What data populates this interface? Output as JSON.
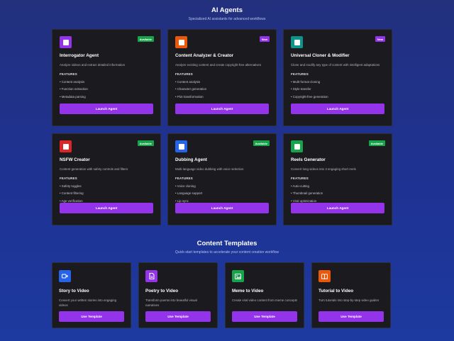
{
  "agents_section": {
    "title": "AI Agents",
    "subtitle": "Specialized AI assistants for advanced workflows",
    "features_heading": "FEATURES",
    "cards": [
      {
        "title": "Interrogator Agent",
        "badge": "Available",
        "badge_color": "#16a34a",
        "icon_color": "#9333ea",
        "icon_name": "agent-icon",
        "description": "Analyze videos and extract detailed information",
        "features": [
          "Content analysis",
          "Function extraction",
          "Metadata parsing"
        ],
        "button": "Launch Agent"
      },
      {
        "title": "Content Analyzer & Creator",
        "badge": "New",
        "badge_color": "#9333ea",
        "icon_color": "#ea580c",
        "icon_name": "agent-icon",
        "description": "Analyze existing content and create copyright-free alternatives",
        "features": [
          "Content analysis",
          "Character generation",
          "Plot transformation"
        ],
        "button": "Launch Agent"
      },
      {
        "title": "Universal Cloner & Modifier",
        "badge": "New",
        "badge_color": "#9333ea",
        "icon_color": "#0d9488",
        "icon_name": "agent-icon",
        "description": "Clone and modify any type of content with intelligent adaptations",
        "features": [
          "Multi-format cloning",
          "Style transfer",
          "Copyright-free generation"
        ],
        "button": "Launch Agent"
      },
      {
        "title": "NSFW Creator",
        "badge": "Available",
        "badge_color": "#16a34a",
        "icon_color": "#dc2626",
        "icon_name": "agent-icon",
        "description": "Content generation with safety controls and filters",
        "features": [
          "Safety toggles",
          "Content filtering",
          "Age verification"
        ],
        "button": "Launch Agent"
      },
      {
        "title": "Dubbing Agent",
        "badge": "Available",
        "badge_color": "#16a34a",
        "icon_color": "#2563eb",
        "icon_name": "agent-icon",
        "description": "Multi-language video dubbing with voice selection",
        "features": [
          "Voice cloning",
          "Language support",
          "Lip sync"
        ],
        "button": "Launch Agent"
      },
      {
        "title": "Reels Generator",
        "badge": "Available",
        "badge_color": "#16a34a",
        "icon_color": "#16a34a",
        "icon_name": "agent-icon",
        "description": "Convert long videos into 3 engaging short reels",
        "features": [
          "Auto-cutting",
          "Thumbnail generation",
          "Viral optimization"
        ],
        "button": "Launch Agent"
      }
    ]
  },
  "templates_section": {
    "title": "Content Templates",
    "subtitle": "Quick-start templates to accelerate your content creation workflow",
    "cards": [
      {
        "title": "Story to Video",
        "icon_color": "#2563eb",
        "icon_name": "video-icon",
        "description": "Convert your written stories into engaging videos",
        "button": "Use Template"
      },
      {
        "title": "Poetry to Video",
        "icon_color": "#9333ea",
        "icon_name": "document-icon",
        "description": "Transform poems into beautiful visual narratives",
        "button": "Use Template"
      },
      {
        "title": "Meme to Video",
        "icon_color": "#16a34a",
        "icon_name": "image-icon",
        "description": "Create viral video content from meme concepts",
        "button": "Use Template"
      },
      {
        "title": "Tutorial to Video",
        "icon_color": "#ea580c",
        "icon_name": "book-icon",
        "description": "Turn tutorials into step-by-step video guides",
        "button": "Use Template"
      }
    ]
  }
}
